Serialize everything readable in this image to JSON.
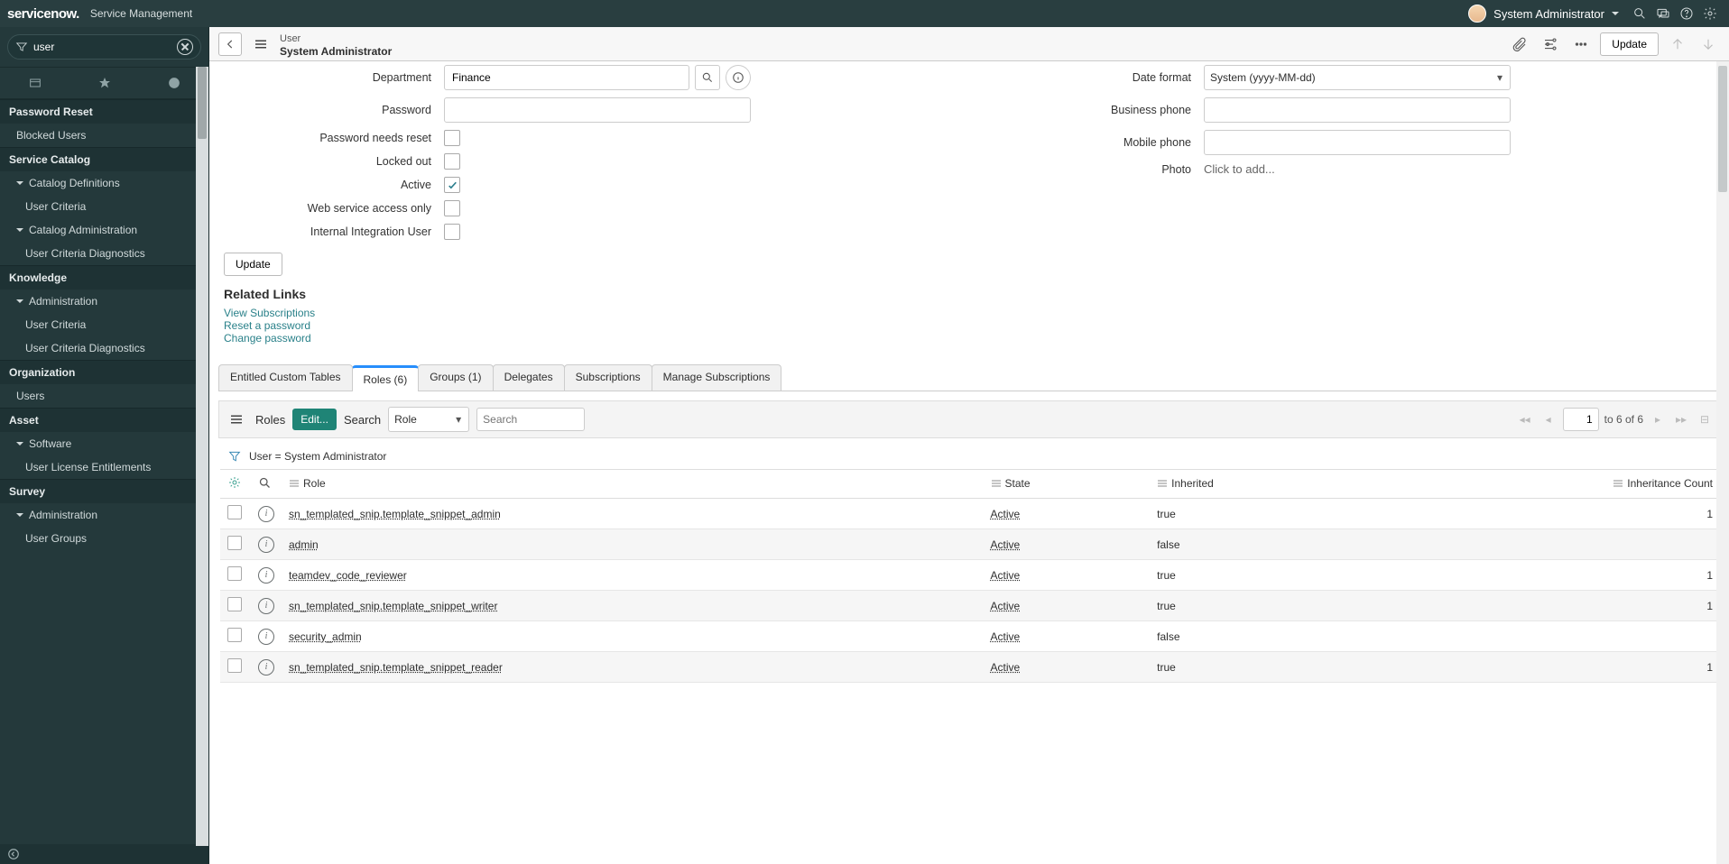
{
  "banner": {
    "product": "servicenow.",
    "subtitle": "Service Management",
    "user": "System Administrator"
  },
  "nav": {
    "filter": "user",
    "sections": [
      {
        "app": "Password Reset",
        "items": [
          {
            "t": "Blocked Users"
          }
        ]
      },
      {
        "app": "Service Catalog",
        "items": [
          {
            "t": "Catalog Definitions",
            "exp": true
          },
          {
            "t": "User Criteria",
            "sub": true
          },
          {
            "t": "Catalog Administration",
            "exp": true
          },
          {
            "t": "User Criteria Diagnostics",
            "sub": true
          }
        ]
      },
      {
        "app": "Knowledge",
        "items": [
          {
            "t": "Administration",
            "exp": true
          },
          {
            "t": "User Criteria",
            "sub": true
          },
          {
            "t": "User Criteria Diagnostics",
            "sub": true
          }
        ]
      },
      {
        "app": "Organization",
        "items": [
          {
            "t": "Users"
          }
        ]
      },
      {
        "app": "Asset",
        "items": [
          {
            "t": "Software",
            "exp": true
          },
          {
            "t": "User License Entitlements",
            "sub": true
          }
        ]
      },
      {
        "app": "Survey",
        "items": [
          {
            "t": "Administration",
            "exp": true
          },
          {
            "t": "User Groups",
            "sub": true
          }
        ]
      }
    ]
  },
  "header": {
    "type": "User",
    "display": "System Administrator",
    "update": "Update"
  },
  "form": {
    "left": {
      "department_label": "Department",
      "department": "Finance",
      "password_label": "Password",
      "needs_reset_label": "Password needs reset",
      "locked_label": "Locked out",
      "active_label": "Active",
      "ws_label": "Web service access only",
      "intg_label": "Internal Integration User"
    },
    "right": {
      "datefmt_label": "Date format",
      "datefmt": "System (yyyy-MM-dd)",
      "bphone_label": "Business phone",
      "mphone_label": "Mobile phone",
      "photo_label": "Photo",
      "photo_hint": "Click to add..."
    },
    "update_btn": "Update"
  },
  "related": {
    "title": "Related Links",
    "links": [
      "View Subscriptions",
      "Reset a password",
      "Change password"
    ]
  },
  "tabs": [
    "Entitled Custom Tables",
    "Roles (6)",
    "Groups (1)",
    "Delegates",
    "Subscriptions",
    "Manage Subscriptions"
  ],
  "list": {
    "title": "Roles",
    "edit": "Edit...",
    "search_label": "Search",
    "search_field": "Role",
    "search_ph": "Search",
    "page": "1",
    "page_suffix": "to 6 of 6",
    "breadcrumb": "User = System Administrator",
    "cols": {
      "role": "Role",
      "state": "State",
      "inh": "Inherited",
      "cnt": "Inheritance Count"
    },
    "rows": [
      {
        "role": "sn_templated_snip.template_snippet_admin",
        "state": "Active",
        "inh": "true",
        "cnt": "1"
      },
      {
        "role": "admin",
        "state": "Active",
        "inh": "false",
        "cnt": ""
      },
      {
        "role": "teamdev_code_reviewer",
        "state": "Active",
        "inh": "true",
        "cnt": "1"
      },
      {
        "role": "sn_templated_snip.template_snippet_writer",
        "state": "Active",
        "inh": "true",
        "cnt": "1"
      },
      {
        "role": "security_admin",
        "state": "Active",
        "inh": "false",
        "cnt": ""
      },
      {
        "role": "sn_templated_snip.template_snippet_reader",
        "state": "Active",
        "inh": "true",
        "cnt": "1"
      }
    ]
  }
}
